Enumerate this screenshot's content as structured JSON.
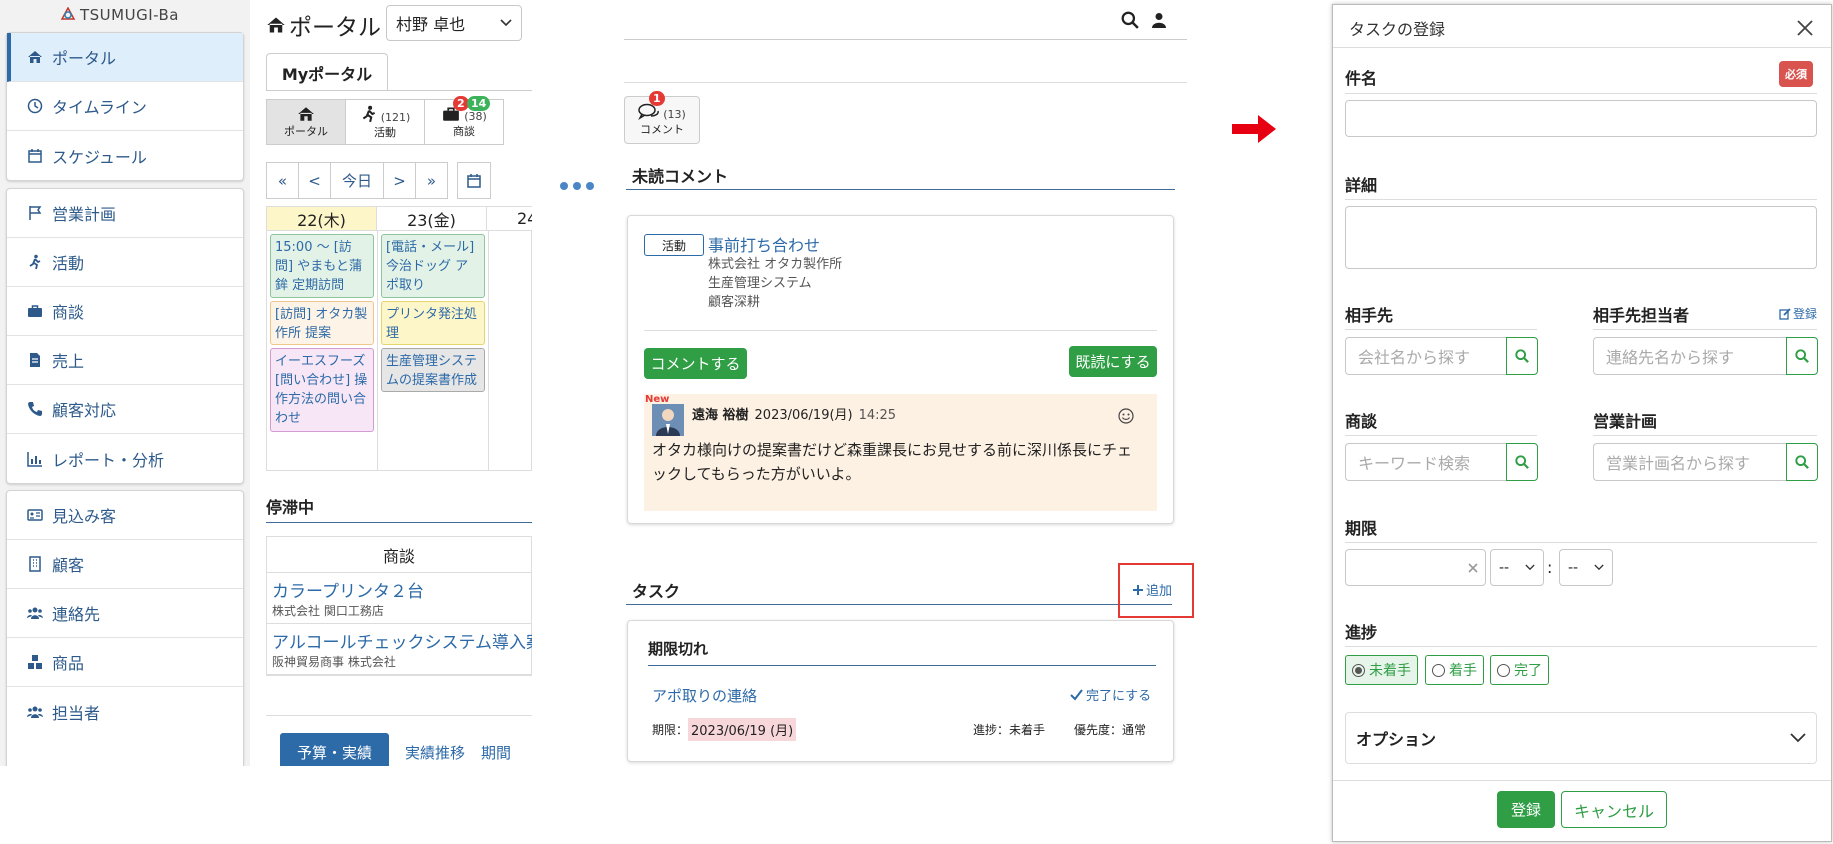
{
  "sidebar": {
    "logo": "TSUMUGI-Ba",
    "group1": [
      {
        "label": "ポータル",
        "icon": "home-icon",
        "active": true
      },
      {
        "label": "タイムライン",
        "icon": "clock-icon"
      },
      {
        "label": "スケジュール",
        "icon": "calendar-icon"
      }
    ],
    "group2": [
      {
        "label": "営業計画",
        "icon": "flag-icon"
      },
      {
        "label": "活動",
        "icon": "running-icon"
      },
      {
        "label": "商談",
        "icon": "briefcase-icon"
      },
      {
        "label": "売上",
        "icon": "document-icon"
      },
      {
        "label": "顧客対応",
        "icon": "phone-icon"
      },
      {
        "label": "レポート・分析",
        "icon": "bar-chart-icon"
      }
    ],
    "group3": [
      {
        "label": "見込み客",
        "icon": "id-card-icon"
      },
      {
        "label": "顧客",
        "icon": "building-icon"
      },
      {
        "label": "連絡先",
        "icon": "users-icon"
      },
      {
        "label": "商品",
        "icon": "boxes-icon"
      },
      {
        "label": "担当者",
        "icon": "users-icon"
      }
    ]
  },
  "portal": {
    "title": "ポータル",
    "user_select": "村野 卓也",
    "my_tab": "Myポータル",
    "icon_tabs": [
      {
        "label": "ポータル",
        "count": ""
      },
      {
        "label": "活動",
        "count": "(121)"
      },
      {
        "label": "商談",
        "count": "(38)",
        "badge_red": "2",
        "badge_green": "14"
      }
    ],
    "nav": {
      "first": "«",
      "prev": "<",
      "today": "今日",
      "next": ">",
      "last": "»"
    },
    "days": [
      "22(木)",
      "23(金)",
      "24"
    ],
    "events": {
      "d1": [
        {
          "text": "15:00 ～ [訪問] やまもと蒲鉾 定期訪問",
          "color": "#e3f2e6",
          "border": "#8fc49c"
        },
        {
          "text": "[訪問] オタカ製作所 提案",
          "color": "#fdf3e6",
          "border": "#efc68c"
        },
        {
          "text": "イーエスフーズ [問い合わせ] 操作方法の問い合わせ",
          "color": "#f6e6f6",
          "border": "#d39ad3"
        }
      ],
      "d2": [
        {
          "text": "[電話・メール] 今治ドッグ アポ取り",
          "color": "#e3f2e6",
          "border": "#8fc49c"
        },
        {
          "text": "プリンタ発注処理",
          "color": "#fdf6c8",
          "border": "#e5d56a"
        },
        {
          "text": "生産管理システムの提案書作成",
          "color": "#e6e6e6",
          "border": "#aaaaaa"
        }
      ]
    },
    "stalled": {
      "title": "停滞中",
      "col_header": "商談",
      "rows": [
        {
          "name": "カラープリンタ２台",
          "company": "株式会社 関口工務店"
        },
        {
          "name": "アルコールチェックシステム導入案件",
          "company": "阪神貿易商事 株式会社"
        }
      ]
    },
    "bottom_tabs": [
      "予算・実績",
      "実績推移",
      "期間"
    ]
  },
  "middle": {
    "comment_btn": {
      "label": "コメント",
      "count": "(13)",
      "badge": "1"
    },
    "unread_title": "未読コメント",
    "unread_card": {
      "tag": "活動",
      "title": "事前打ち合わせ",
      "lines": [
        "株式会社 オタカ製作所",
        "生産管理システム",
        "顧客深耕"
      ],
      "comment_btn": "コメントする",
      "read_btn": "既読にする",
      "new_label": "New",
      "author": "遠海 裕樹",
      "date": "2023/06/19(月)",
      "time": "14:25",
      "body": "オタカ様向けの提案書だけど森重課長にお見せする前に深川係長にチェックしてもらった方がいいよ。"
    },
    "task_title": "タスク",
    "task_add": "追加",
    "overdue_title": "期限切れ",
    "task": {
      "name": "アポ取りの連絡",
      "complete": "完了にする",
      "due_label": "期限：",
      "due": "2023/06/19 (月)",
      "progress": "進捗：未着手",
      "priority": "優先度：通常"
    }
  },
  "modal": {
    "title": "タスクの登録",
    "subject_label": "件名",
    "required": "必須",
    "detail_label": "詳細",
    "partner_label": "相手先",
    "partner_placeholder": "会社名から探す",
    "contact_label": "相手先担当者",
    "contact_register": "登録",
    "contact_placeholder": "連絡先名から探す",
    "deal_label": "商談",
    "deal_placeholder": "キーワード検索",
    "plan_label": "営業計画",
    "plan_placeholder": "営業計画名から探す",
    "due_label": "期限",
    "hour": "--",
    "minute": "--",
    "time_sep": ":",
    "progress_label": "進捗",
    "progress_options": [
      "未着手",
      "着手",
      "完了"
    ],
    "progress_selected": 0,
    "option_label": "オプション",
    "submit": "登録",
    "cancel": "キャンセル"
  },
  "colors": {
    "primary": "#2d6aa8",
    "green": "#2f9e45",
    "red": "#d9534f",
    "highlight": "#e53935"
  }
}
